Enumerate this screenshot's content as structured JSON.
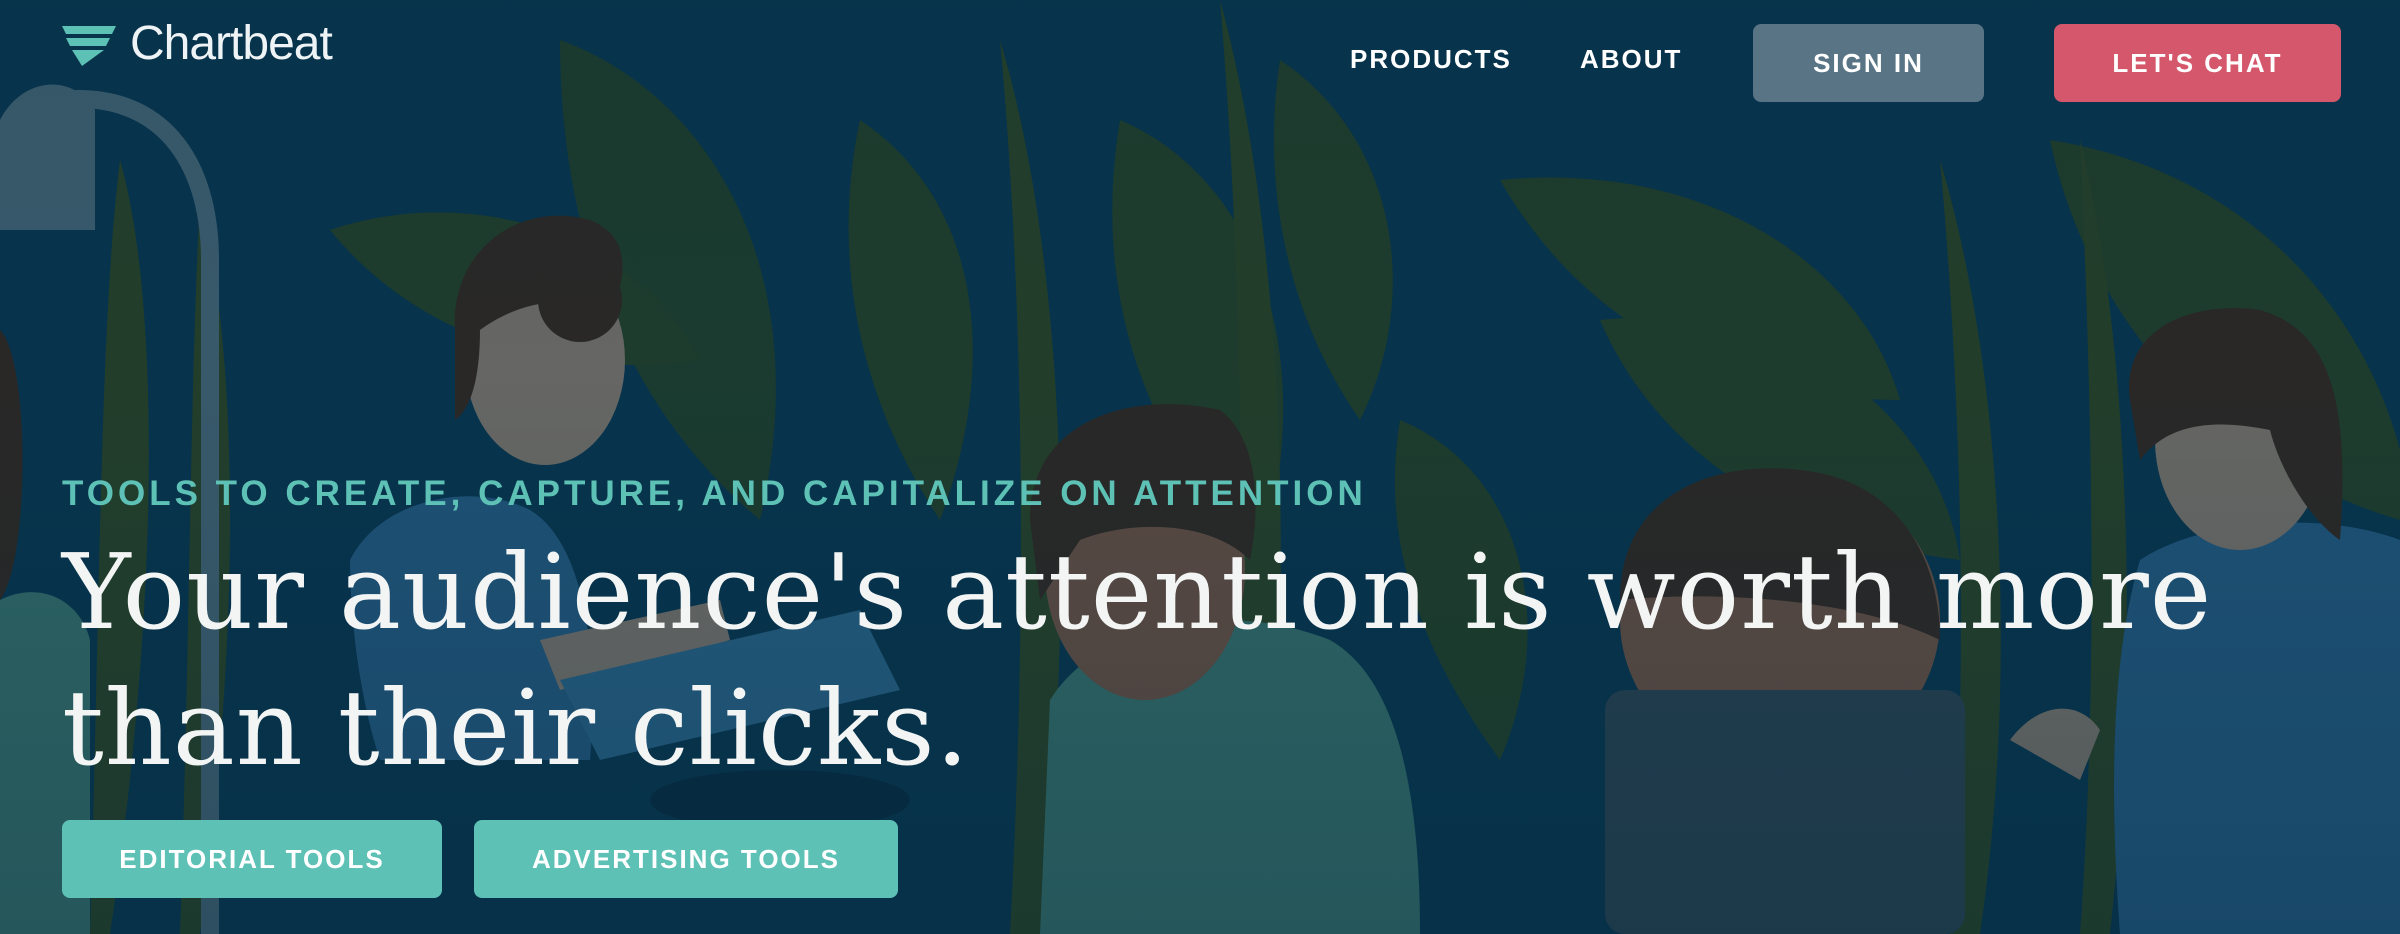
{
  "brand": {
    "name": "Chartbeat",
    "icon": "chartbeat-logo-icon",
    "accent": "#5ec1b6"
  },
  "nav": {
    "products_label": "PRODUCTS",
    "about_label": "ABOUT",
    "sign_in_label": "SIGN IN",
    "chat_label": "LET'S CHAT"
  },
  "hero": {
    "eyebrow": "TOOLS TO CREATE, CAPTURE, AND CAPITALIZE ON ATTENTION",
    "headline": "Your audience's attention is worth more than their clicks.",
    "editorial_label": "EDITORIAL TOOLS",
    "advertising_label": "ADVERTISING TOOLS"
  },
  "colors": {
    "background": "#07344d",
    "chat_button": "#d5576b",
    "sign_in_button": "#587485",
    "teal": "#5ec1b6"
  }
}
